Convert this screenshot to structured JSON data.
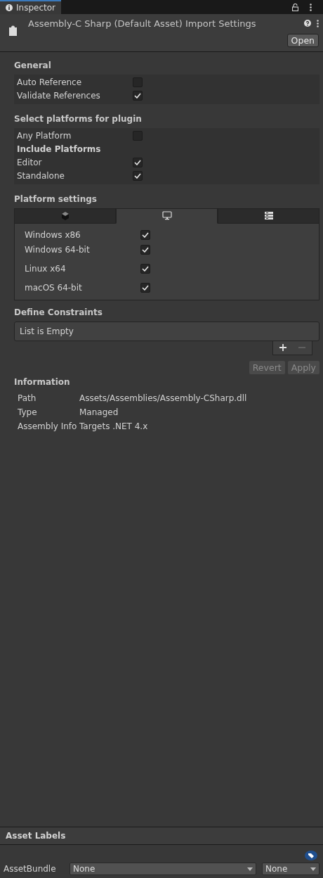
{
  "window": {
    "tab_title": "Inspector"
  },
  "header": {
    "title": "Assembly-C Sharp (Default Asset) Import Settings",
    "open_button": "Open"
  },
  "general": {
    "title": "General",
    "rows": [
      {
        "label": "Auto Reference",
        "kind": "checkbox",
        "checked": false
      },
      {
        "label": "Validate References",
        "kind": "checkbox",
        "checked": true
      }
    ]
  },
  "platforms": {
    "title": "Select platforms for plugin",
    "rows": [
      {
        "label": "Any Platform",
        "kind": "checkbox",
        "checked": false
      },
      {
        "label": "Include Platforms",
        "kind": "heading"
      },
      {
        "label": "Editor",
        "kind": "checkbox",
        "checked": true
      },
      {
        "label": "Standalone",
        "kind": "checkbox",
        "checked": true
      }
    ]
  },
  "platform_settings": {
    "title": "Platform settings",
    "tabs": [
      {
        "selected": false
      },
      {
        "selected": true
      },
      {
        "selected": false
      }
    ],
    "rows": [
      {
        "label": "Windows x86",
        "checked": true
      },
      {
        "label": "Windows 64-bit",
        "checked": true
      },
      {
        "label": "Linux x64",
        "checked": true
      },
      {
        "label": "macOS 64-bit",
        "checked": true
      }
    ]
  },
  "define_constraints": {
    "title": "Define Constraints",
    "empty_text": "List is Empty",
    "add_disabled": false,
    "remove_disabled": true
  },
  "buttons": [
    {
      "label": "Revert",
      "disabled": true
    },
    {
      "label": "Apply",
      "disabled": true
    }
  ],
  "information": {
    "title": "Information",
    "rows": [
      {
        "label": "Path",
        "value": "Assets/Assemblies/Assembly-CSharp.dll"
      },
      {
        "label": "Type",
        "value": "Managed"
      },
      {
        "label": "Assembly Info",
        "value": "Targets .NET 4.x"
      }
    ]
  },
  "asset_labels": {
    "title": "Asset Labels",
    "bundle_label": "AssetBundle",
    "bundle": "None",
    "variant": "None"
  }
}
